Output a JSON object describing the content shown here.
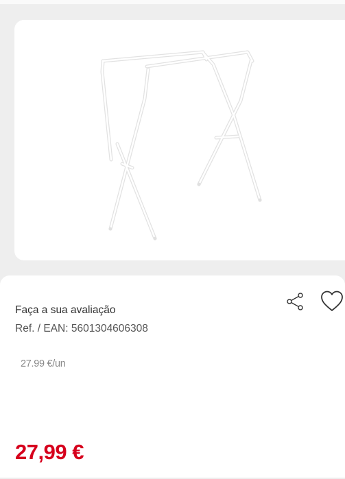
{
  "product": {
    "image_alt": "white folding bath stand",
    "rating_prompt": "Faça a sua avaliação",
    "ref_label": "Ref. / EAN:",
    "ref_value": "5601304606308",
    "unit_price": "27.99 €/un",
    "price": "27,99 €"
  },
  "actions": {
    "share_icon": "share-icon",
    "favorite_icon": "heart-outline-icon"
  },
  "colors": {
    "price": "#d6001c",
    "background": "#eeeeee",
    "card": "#ffffff"
  }
}
